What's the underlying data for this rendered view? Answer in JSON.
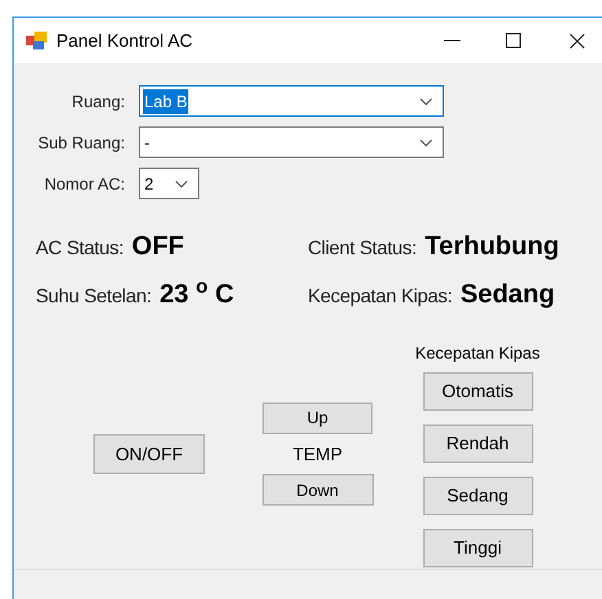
{
  "window": {
    "title": "Panel Kontrol AC"
  },
  "fields": [
    {
      "label": "Ruang:",
      "value": "Lab B",
      "focused": true,
      "kind": "wide"
    },
    {
      "label": "Sub Ruang:",
      "value": "-",
      "focused": false,
      "kind": "wide"
    },
    {
      "label": "Nomor AC:",
      "value": "2",
      "focused": false,
      "kind": "narrow"
    }
  ],
  "status": [
    {
      "label": "AC Status:",
      "value": "OFF"
    },
    {
      "label": "Client Status:",
      "value": "Terhubung"
    },
    {
      "label": "Suhu Setelan:",
      "value": "23 $^{o}$ C"
    },
    {
      "label": "Kecepatan Kipas:",
      "value": "Sedang"
    }
  ],
  "power_button": "ON/OFF",
  "temp": {
    "up": "Up",
    "label": "TEMP",
    "down": "Down"
  },
  "fan": {
    "title": "Kecepatan Kipas",
    "buttons": [
      "Otomatis",
      "Rendah",
      "Sedang",
      "Tinggi"
    ]
  }
}
